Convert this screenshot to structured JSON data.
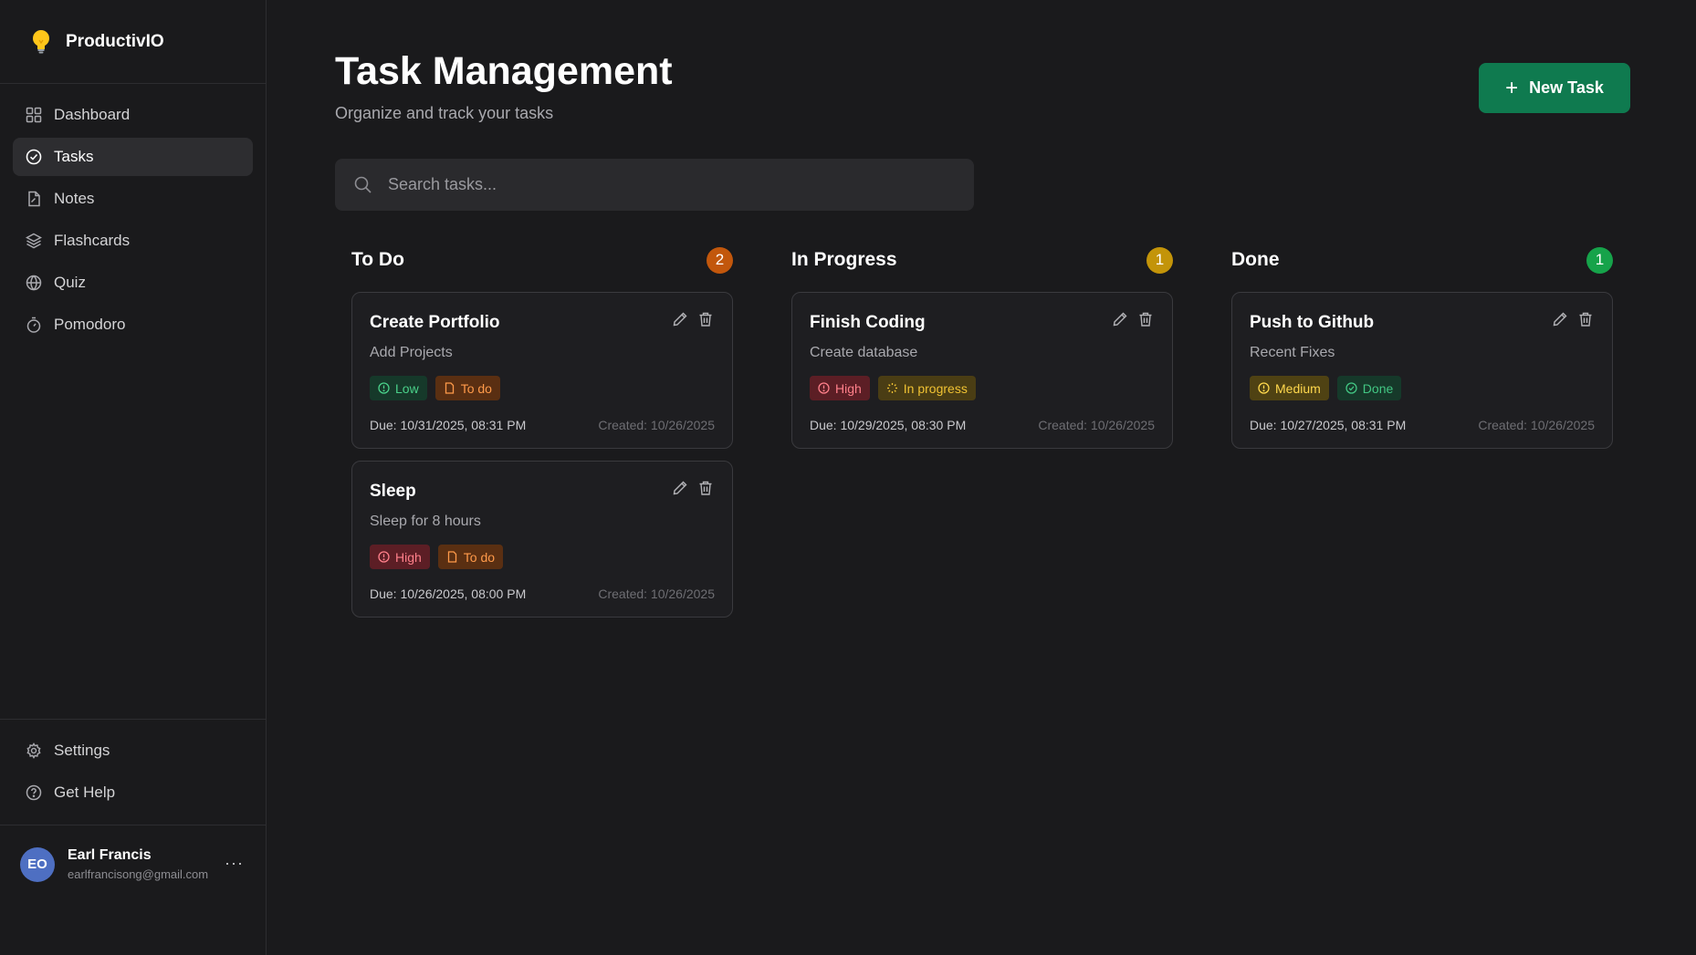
{
  "app": {
    "name": "ProductivIO"
  },
  "sidebar": {
    "items": [
      {
        "label": "Dashboard",
        "icon": "dashboard-icon"
      },
      {
        "label": "Tasks",
        "icon": "check-circle-icon",
        "active": true
      },
      {
        "label": "Notes",
        "icon": "notes-icon"
      },
      {
        "label": "Flashcards",
        "icon": "layers-icon"
      },
      {
        "label": "Quiz",
        "icon": "globe-icon"
      },
      {
        "label": "Pomodoro",
        "icon": "timer-icon"
      }
    ],
    "bottom": [
      {
        "label": "Settings",
        "icon": "gear-icon"
      },
      {
        "label": "Get Help",
        "icon": "help-icon"
      }
    ],
    "user": {
      "initials": "EO",
      "name": "Earl Francis",
      "email": "earlfrancisong@gmail.com",
      "more": "···"
    }
  },
  "header": {
    "title": "Task Management",
    "subtitle": "Organize and track your tasks",
    "new_task_label": "New Task"
  },
  "search": {
    "placeholder": "Search tasks...",
    "value": ""
  },
  "columns": [
    {
      "title": "To Do",
      "count": "2",
      "count_color": "#c2570c",
      "cards": [
        {
          "title": "Create Portfolio",
          "description": "Add Projects",
          "priority": "Low",
          "status": "To do",
          "due": "Due: 10/31/2025, 08:31 PM",
          "created": "Created: 10/26/2025"
        },
        {
          "title": "Sleep",
          "description": "Sleep for 8 hours",
          "priority": "High",
          "status": "To do",
          "due": "Due: 10/26/2025, 08:00 PM",
          "created": "Created: 10/26/2025"
        }
      ]
    },
    {
      "title": "In Progress",
      "count": "1",
      "count_color": "#c39409",
      "cards": [
        {
          "title": "Finish Coding",
          "description": "Create database",
          "priority": "High",
          "status": "In progress",
          "due": "Due: 10/29/2025, 08:30 PM",
          "created": "Created: 10/26/2025"
        }
      ]
    },
    {
      "title": "Done",
      "count": "1",
      "count_color": "#16a34a",
      "cards": [
        {
          "title": "Push to Github",
          "description": "Recent Fixes",
          "priority": "Medium",
          "status": "Done",
          "due": "Due: 10/27/2025, 08:31 PM",
          "created": "Created: 10/26/2025"
        }
      ]
    }
  ],
  "colors": {
    "accent": "#0f7a4f",
    "background": "#1a1a1c",
    "card": "#1e1e21"
  }
}
